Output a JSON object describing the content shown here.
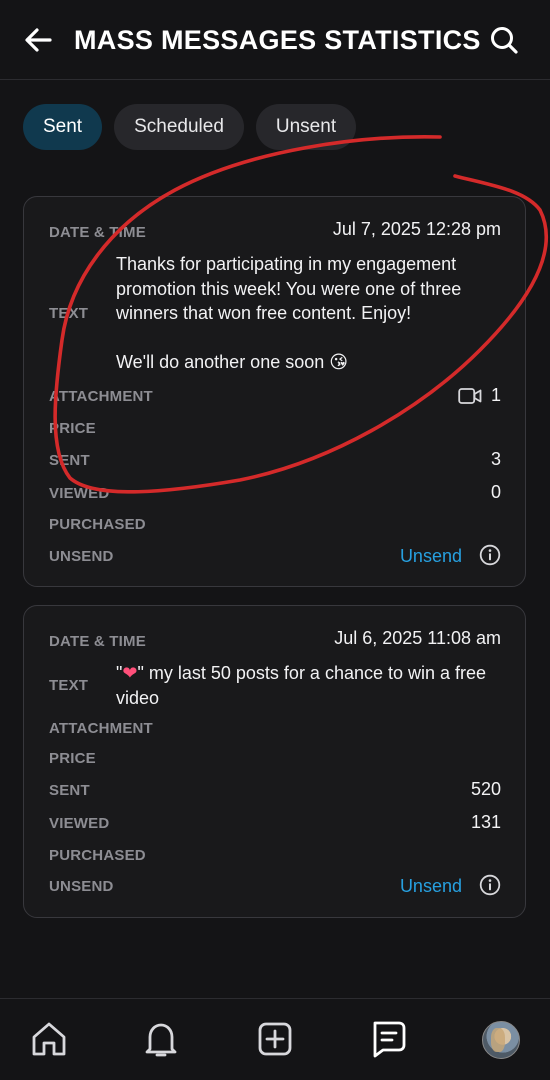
{
  "header": {
    "title": "MASS MESSAGES STATISTICS"
  },
  "tabs": [
    {
      "label": "Sent",
      "active": true
    },
    {
      "label": "Scheduled",
      "active": false
    },
    {
      "label": "Unsent",
      "active": false
    }
  ],
  "labels": {
    "date_time": "DATE & TIME",
    "text": "TEXT",
    "attachment": "ATTACHMENT",
    "price": "PRICE",
    "sent": "SENT",
    "viewed": "VIEWED",
    "purchased": "PURCHASED",
    "unsend": "UNSEND"
  },
  "messages": [
    {
      "date_time": "Jul 7, 2025 12:28 pm",
      "text_line1": "Thanks for participating in my engagement promotion this week! You were one of three winners that won free content. Enjoy!",
      "text_line2": "We'll do another one soon 😘",
      "attachment_count": "1",
      "price": "",
      "sent": "3",
      "viewed": "0",
      "purchased": "",
      "unsend_label": "Unsend"
    },
    {
      "date_time": "Jul 6, 2025 11:08 am",
      "text_prefix": "\"",
      "text_heart": "❤",
      "text_rest": "\" my last 50 posts for a chance to win a free video",
      "price": "",
      "sent": "520",
      "viewed": "131",
      "purchased": "",
      "unsend_label": "Unsend"
    }
  ],
  "icons": {
    "back": "arrow-left-icon",
    "search": "search-icon",
    "video": "video-camera-icon",
    "info": "info-circle-icon",
    "nav": [
      "home-icon",
      "bell-icon",
      "plus-square-icon",
      "chat-icon",
      "avatar"
    ]
  },
  "colors": {
    "background": "#141416",
    "tab_active": "#10394e",
    "link": "#27a0e0",
    "annotation": "#d42a2a"
  }
}
